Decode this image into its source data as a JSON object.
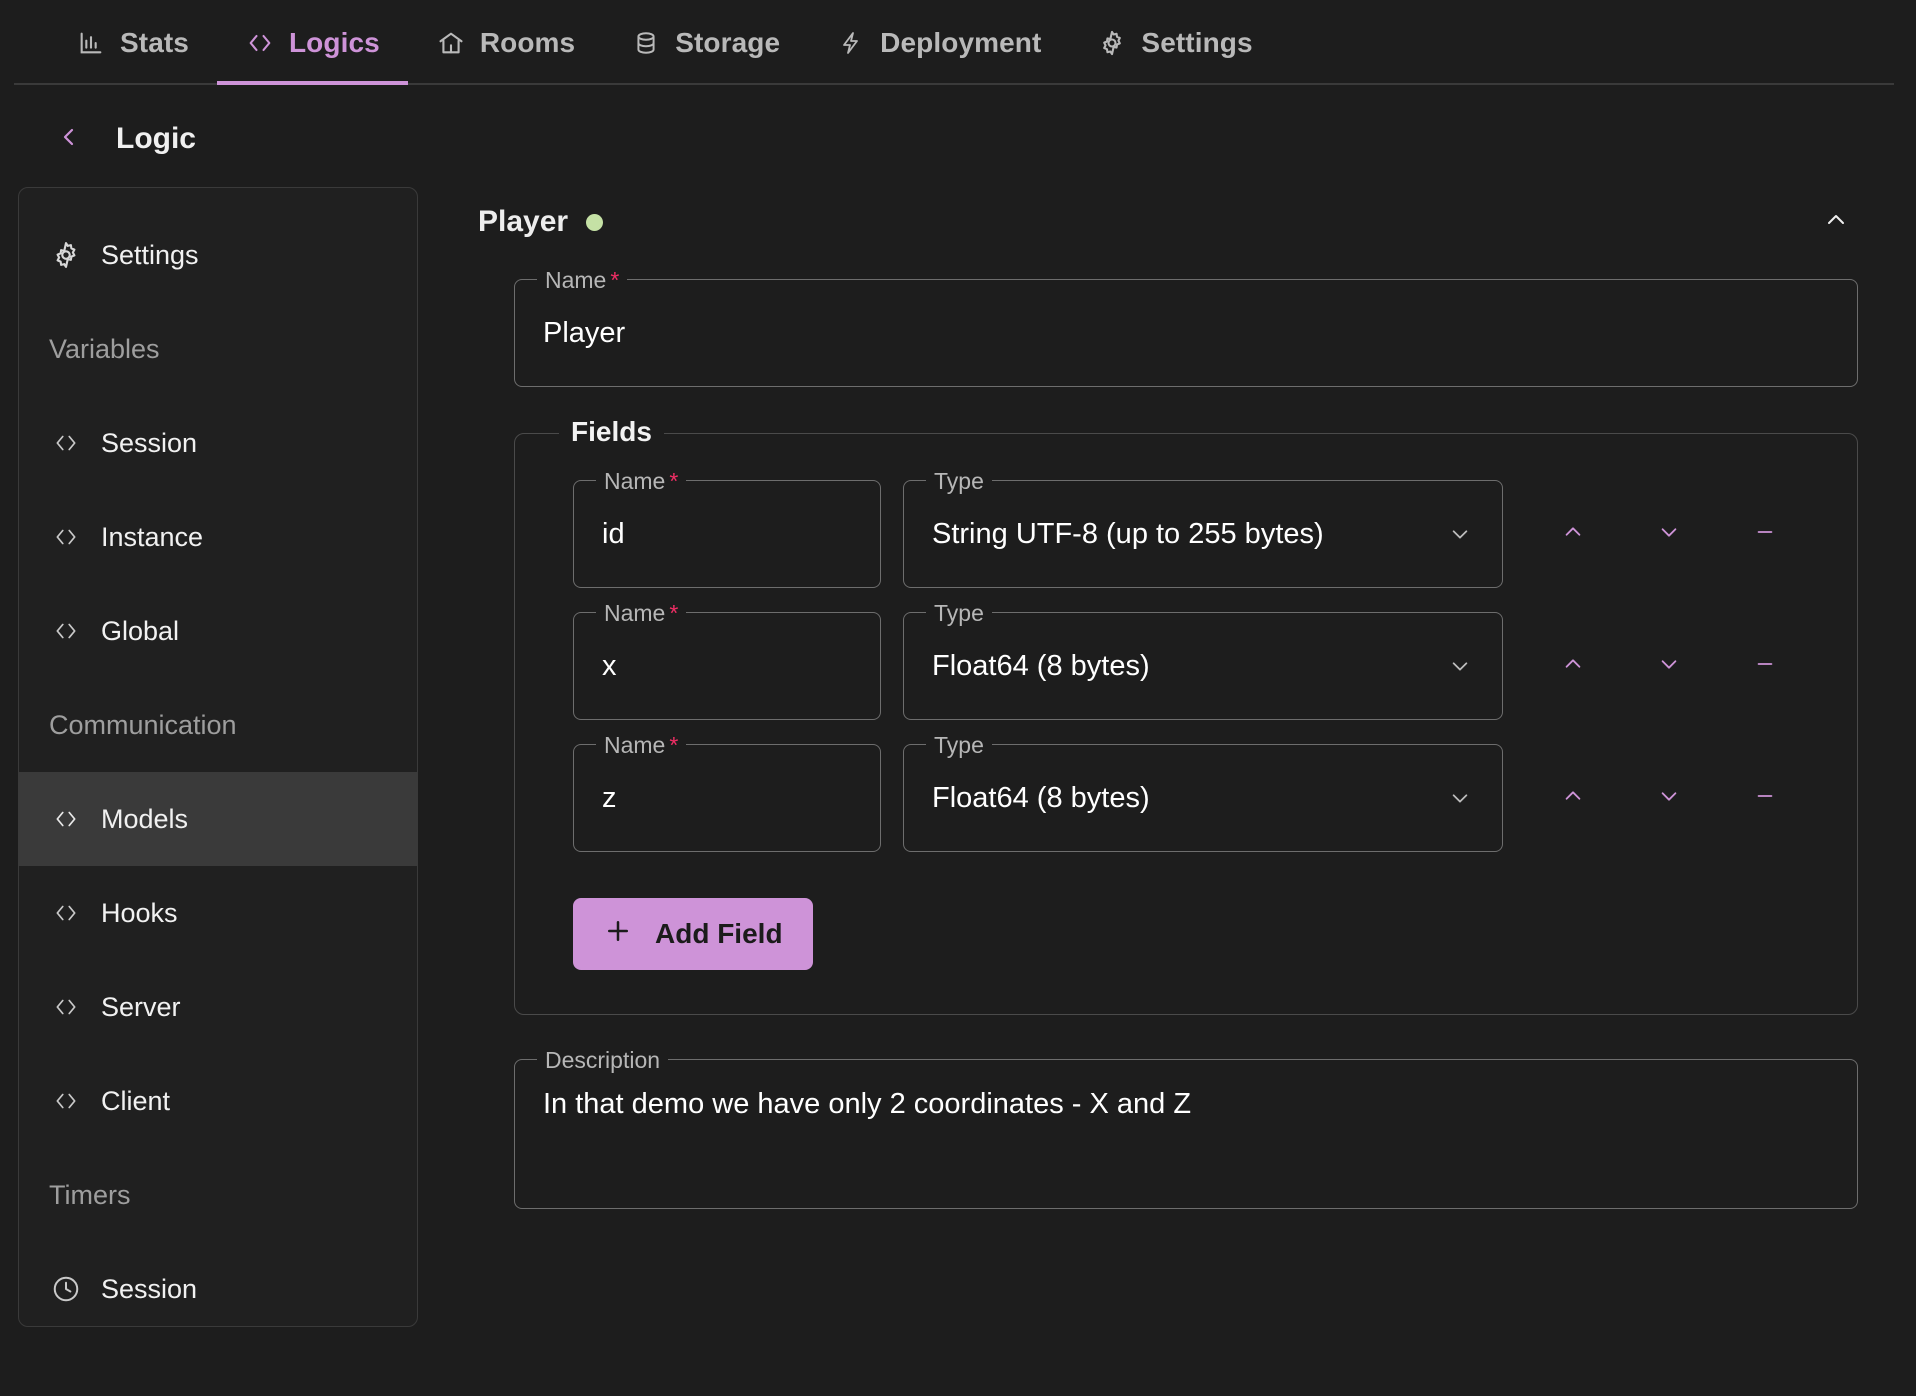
{
  "topnav": {
    "tabs": [
      {
        "label": "Stats",
        "icon": "chart-bar-icon",
        "active": false
      },
      {
        "label": "Logics",
        "icon": "code-brackets-icon",
        "active": true
      },
      {
        "label": "Rooms",
        "icon": "home-icon",
        "active": false
      },
      {
        "label": "Storage",
        "icon": "database-icon",
        "active": false
      },
      {
        "label": "Deployment",
        "icon": "bolt-icon",
        "active": false
      },
      {
        "label": "Settings",
        "icon": "gear-icon",
        "active": false
      }
    ]
  },
  "page": {
    "back_label": "<",
    "title": "Logic"
  },
  "sidebar": {
    "items": [
      {
        "label": "Settings",
        "icon": "gear-icon",
        "type": "item",
        "selected": false
      },
      {
        "label": "Variables",
        "icon": "",
        "type": "header",
        "selected": false
      },
      {
        "label": "Session",
        "icon": "code-brackets-icon",
        "type": "item",
        "selected": false
      },
      {
        "label": "Instance",
        "icon": "code-brackets-icon",
        "type": "item",
        "selected": false
      },
      {
        "label": "Global",
        "icon": "code-brackets-icon",
        "type": "item",
        "selected": false
      },
      {
        "label": "Communication",
        "icon": "",
        "type": "header",
        "selected": false
      },
      {
        "label": "Models",
        "icon": "code-brackets-icon",
        "type": "item",
        "selected": true
      },
      {
        "label": "Hooks",
        "icon": "code-brackets-icon",
        "type": "item",
        "selected": false
      },
      {
        "label": "Server",
        "icon": "code-brackets-icon",
        "type": "item",
        "selected": false
      },
      {
        "label": "Client",
        "icon": "code-brackets-icon",
        "type": "item",
        "selected": false
      },
      {
        "label": "Timers",
        "icon": "",
        "type": "header",
        "selected": false
      },
      {
        "label": "Session",
        "icon": "clock-icon",
        "type": "item",
        "selected": false
      }
    ]
  },
  "main": {
    "model_title": "Player",
    "status_dot_color": "#c5e1a5",
    "collapse_icon": "chevron-up-icon",
    "name": {
      "label": "Name",
      "required": "*",
      "value": "Player"
    },
    "fields_group_label": "Fields",
    "field_labels": {
      "name": "Name",
      "required": "*",
      "type": "Type"
    },
    "fields": [
      {
        "name": "id",
        "type": "String UTF-8 (up to 255 bytes)"
      },
      {
        "name": "x",
        "type": "Float64 (8 bytes)"
      },
      {
        "name": "z",
        "type": "Float64 (8 bytes)"
      }
    ],
    "row_actions": {
      "move_up": "chevron-up-icon",
      "move_down": "chevron-down-icon",
      "remove": "minus-icon"
    },
    "add_field_label": "Add Field",
    "add_field_icon": "plus-icon",
    "description": {
      "label": "Description",
      "value": "In that demo we have only 2 coordinates - X and Z"
    }
  },
  "colors": {
    "accent": "#ce93d8",
    "required": "#f02e65",
    "status_ok": "#c5e1a5",
    "background": "#1d1d1d"
  }
}
